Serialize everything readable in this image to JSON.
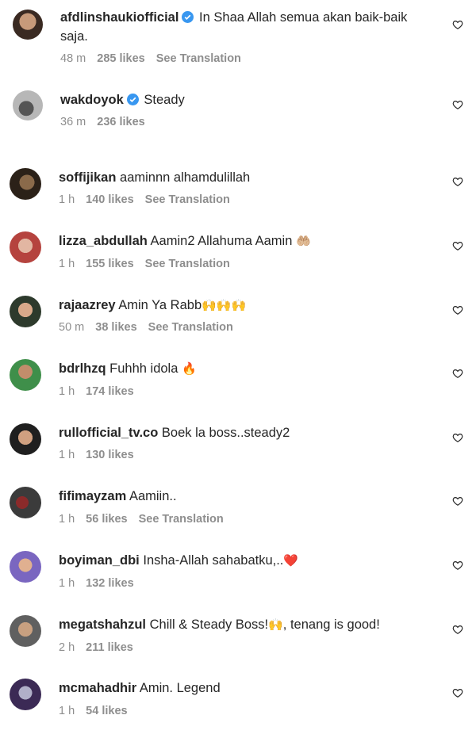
{
  "colors": {
    "text": "#262626",
    "meta": "#8e8e8e",
    "verified": "#3897f0",
    "heart_red": "#e0245e"
  },
  "comments": [
    {
      "username": "afdlinshaukiofficial",
      "verified": true,
      "text": "In Shaa Allah semua akan baik-baik saja.",
      "time": "48 m",
      "likes": "285 likes",
      "translation": "See Translation"
    },
    {
      "username": "wakdoyok",
      "verified": true,
      "text": "Steady",
      "time": "36 m",
      "likes": "236 likes",
      "translation": ""
    },
    {
      "username": "soffijikan",
      "verified": false,
      "text": "aaminnn alhamdulillah",
      "time": "1 h",
      "likes": "140 likes",
      "translation": "See Translation"
    },
    {
      "username": "lizza_abdullah",
      "verified": false,
      "text": "Aamin2 Allahuma Aamin",
      "emoji": "🤲🏼",
      "time": "1 h",
      "likes": "155 likes",
      "translation": "See Translation"
    },
    {
      "username": "rajaazrey",
      "verified": false,
      "text": "Amin Ya Rabb",
      "emoji": "🙌🙌🙌",
      "time": "50 m",
      "likes": "38 likes",
      "translation": "See Translation"
    },
    {
      "username": "bdrlhzq",
      "verified": false,
      "text": "Fuhhh idola",
      "emoji": "🔥",
      "time": "1 h",
      "likes": "174 likes",
      "translation": ""
    },
    {
      "username": "rullofficial_tv.co",
      "verified": false,
      "text": "Boek la boss..steady2",
      "time": "1 h",
      "likes": "130 likes",
      "translation": ""
    },
    {
      "username": "fifimayzam",
      "verified": false,
      "text": "Aamiin..",
      "time": "1 h",
      "likes": "56 likes",
      "translation": "See Translation"
    },
    {
      "username": "boyiman_dbi",
      "verified": false,
      "text": "Insha-Allah sahabatku,..",
      "emoji": "❤️",
      "time": "1 h",
      "likes": "132 likes",
      "translation": ""
    },
    {
      "username": "megatshahzul",
      "verified": false,
      "text": "Chill & Steady Boss!",
      "emoji": "🙌",
      "text_after": ", tenang is good!",
      "time": "2 h",
      "likes": "211 likes",
      "translation": ""
    },
    {
      "username": "mcmahadhir",
      "verified": false,
      "text": "Amin. Legend",
      "time": "1 h",
      "likes": "54 likes",
      "translation": ""
    }
  ]
}
